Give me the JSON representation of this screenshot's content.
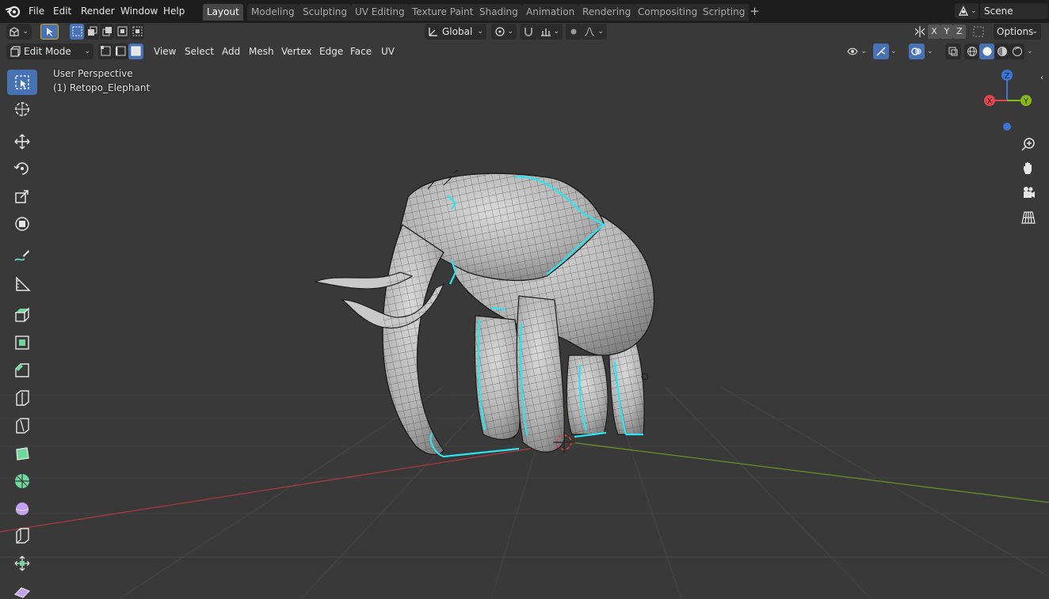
{
  "app": {
    "name": "Blender"
  },
  "menu": [
    "File",
    "Edit",
    "Render",
    "Window",
    "Help"
  ],
  "workspaces": [
    {
      "label": "Layout",
      "active": true
    },
    {
      "label": "Modeling",
      "active": false
    },
    {
      "label": "Sculpting",
      "active": false
    },
    {
      "label": "UV Editing",
      "active": false
    },
    {
      "label": "Texture Paint",
      "active": false
    },
    {
      "label": "Shading",
      "active": false
    },
    {
      "label": "Animation",
      "active": false
    },
    {
      "label": "Rendering",
      "active": false
    },
    {
      "label": "Compositing",
      "active": false
    },
    {
      "label": "Scripting",
      "active": false
    }
  ],
  "scene": {
    "name": "Scene"
  },
  "header": {
    "transform_orientation": "Global",
    "options_label": "Options",
    "axes": [
      "X",
      "Y",
      "Z"
    ]
  },
  "viewport_header": {
    "mode": "Edit Mode",
    "menus": [
      "View",
      "Select",
      "Add",
      "Mesh",
      "Vertex",
      "Edge",
      "Face",
      "UV"
    ]
  },
  "viewport": {
    "view_name": "User Perspective",
    "object_label": "(1) Retopo_Elephant"
  },
  "gizmo": {
    "x": "X",
    "y": "Y",
    "z": "Z"
  },
  "colors": {
    "accent": "#4772b3",
    "selection": "#29e6f0",
    "x_axis": "#e0464b",
    "y_axis": "#86b71b",
    "z_axis": "#3d76d2"
  },
  "tools": [
    {
      "name": "select-box-tool",
      "active": true
    },
    {
      "name": "cursor-tool",
      "active": false
    },
    {
      "name": "move-tool",
      "active": false
    },
    {
      "name": "rotate-tool",
      "active": false
    },
    {
      "name": "scale-tool",
      "active": false
    },
    {
      "name": "transform-tool",
      "active": false
    },
    {
      "name": "annotate-tool",
      "active": false
    },
    {
      "name": "measure-tool",
      "active": false
    },
    {
      "name": "extrude-region-tool",
      "active": false
    },
    {
      "name": "inset-faces-tool",
      "active": false
    },
    {
      "name": "bevel-tool",
      "active": false
    },
    {
      "name": "loop-cut-tool",
      "active": false
    },
    {
      "name": "knife-tool",
      "active": false
    },
    {
      "name": "poly-build-tool",
      "active": false
    },
    {
      "name": "spin-tool",
      "active": false
    },
    {
      "name": "smooth-tool",
      "active": false
    },
    {
      "name": "edge-slide-tool",
      "active": false
    },
    {
      "name": "shrink-fatten-tool",
      "active": false
    },
    {
      "name": "shear-tool",
      "active": false
    }
  ]
}
